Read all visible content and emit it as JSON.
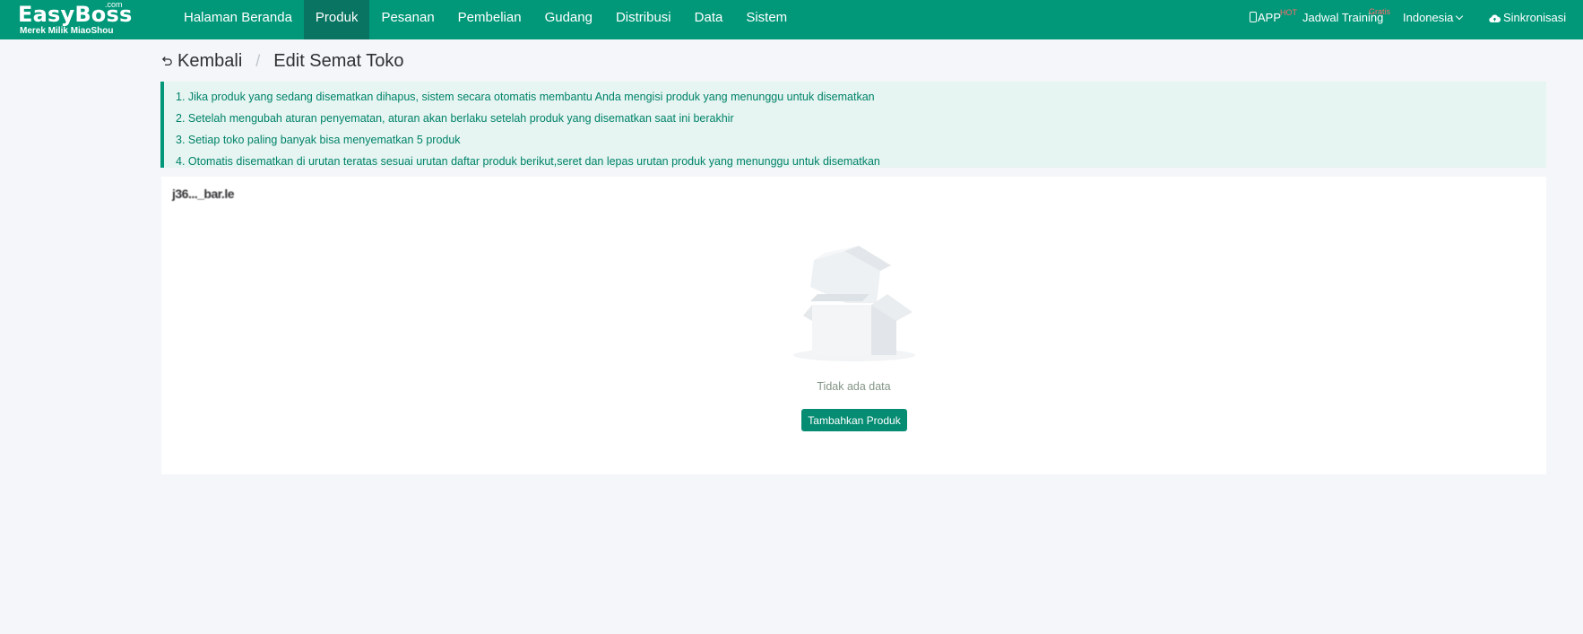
{
  "brand": {
    "name": "EasyBoss",
    "suffix": ".com",
    "tagline": "Merek Milik MiaoShou"
  },
  "nav": {
    "items": [
      {
        "label": "Halaman Beranda",
        "active": false
      },
      {
        "label": "Produk",
        "active": true
      },
      {
        "label": "Pesanan",
        "active": false
      },
      {
        "label": "Pembelian",
        "active": false
      },
      {
        "label": "Gudang",
        "active": false
      },
      {
        "label": "Distribusi",
        "active": false
      },
      {
        "label": "Data",
        "active": false
      },
      {
        "label": "Sistem",
        "active": false
      }
    ],
    "app_label": "APP",
    "app_badge": "HOT",
    "training_label": "Jadwal Training",
    "training_badge": "Gratis",
    "language": "Indonesia",
    "sync_label": "Sinkronisasi"
  },
  "breadcrumb": {
    "back_label": "Kembali",
    "separator": "/",
    "current": "Edit Semat Toko"
  },
  "notice": {
    "lines": [
      "1. Jika produk yang sedang disematkan dihapus, sistem secara otomatis membantu Anda mengisi produk yang menunggu untuk disematkan",
      "2. Setelah mengubah aturan penyematan, aturan akan berlaku setelah produk yang disematkan saat ini berakhir",
      "3. Setiap toko paling banyak bisa menyematkan 5 produk",
      "4. Otomatis disematkan di urutan teratas sesuai urutan daftar produk berikut,seret dan lepas urutan produk yang menunggu untuk disematkan"
    ]
  },
  "panel": {
    "shop_name": "j36..._bar.le",
    "empty_text": "Tidak ada data",
    "add_button": "Tambahkan Produk"
  },
  "colors": {
    "primary": "#009879",
    "nav_active": "#087461",
    "notice_bg": "#e6f5f1",
    "notice_text": "#00826a",
    "badge": "#ff6b6b"
  }
}
